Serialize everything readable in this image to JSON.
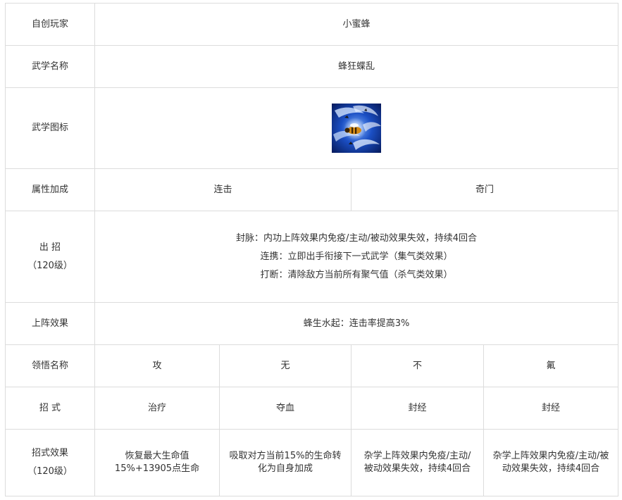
{
  "rows": {
    "creator": {
      "label": "自创玩家",
      "value": "小蜜蜂"
    },
    "martial_name": {
      "label": "武学名称",
      "value": "蜂狂蝶乱"
    },
    "martial_icon": {
      "label": "武学图标",
      "icon": "bee-skill-icon"
    },
    "attributes": {
      "label": "属性加成",
      "values": [
        "连击",
        "奇门"
      ]
    },
    "skills": {
      "label": "出 招",
      "label_sub": "（120级）",
      "lines": [
        "封脉：内功上阵效果内免疫/主动/被动效果失效，持续4回合",
        "连携：立即出手衔接下一式武学（集气类效果）",
        "打断：清除敌方当前所有聚气值（杀气类效果）"
      ]
    },
    "formation": {
      "label": "上阵效果",
      "value": "蜂生水起：连击率提高3%"
    },
    "comprehension": {
      "label": "领悟名称",
      "values": [
        "攻",
        "无",
        "不",
        "氟"
      ]
    },
    "moves": {
      "label": "招 式",
      "values": [
        "治疗",
        "夺血",
        "封经",
        "封经"
      ]
    },
    "move_effects": {
      "label": "招式效果",
      "label_sub": "（120级）",
      "values": [
        [
          "恢复最大生命值",
          "15%+13905点生命"
        ],
        [
          "吸取对方当前15%的生命转",
          "化为自身加成"
        ],
        [
          "杂学上阵效果内免疫/主动/",
          "被动效果失效，持续4回合"
        ],
        [
          "杂学上阵效果内免疫/主动/被",
          "动效果失效，持续4回合"
        ]
      ]
    }
  }
}
